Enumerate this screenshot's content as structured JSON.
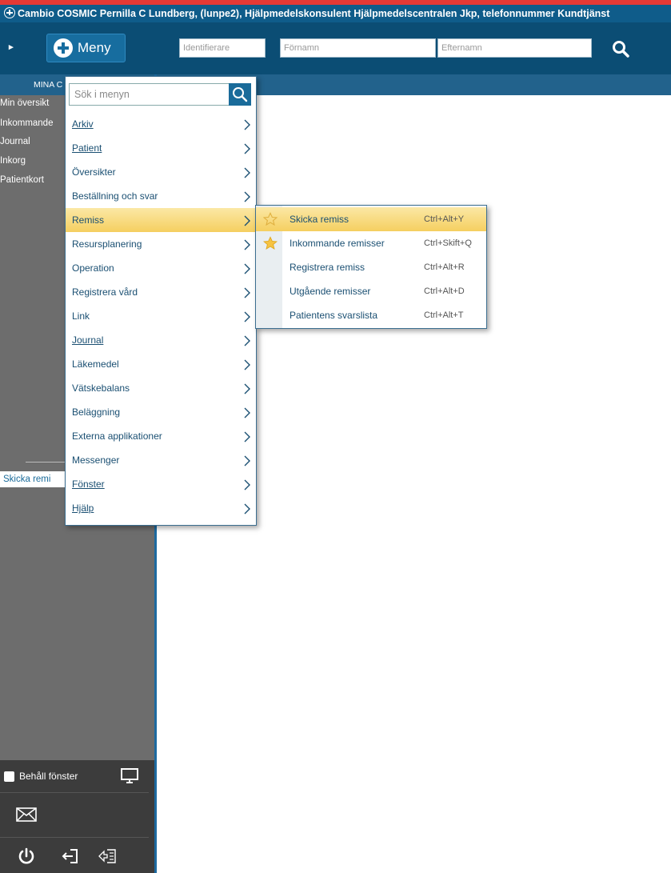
{
  "titlebar": {
    "text": "Cambio COSMIC Pernilla C  Lundberg, (lunpe2), Hjälpmedelskonsulent Hjälpmedelscentralen Jkp, telefonnummer Kundtjänst"
  },
  "toolbar": {
    "menu_label": "Meny",
    "identifier_placeholder": "Identifierare",
    "firstname_placeholder": "Förnamn",
    "lastname_placeholder": "Efternamn"
  },
  "sidebar": {
    "header": "MINA C",
    "items": [
      "Min översikt",
      "Inkommande",
      "Journal",
      "Inkorg",
      "Patientkort"
    ],
    "active_item": "Skicka remi",
    "keep_window_label": "Behåll fönster"
  },
  "menu": {
    "search_placeholder": "Sök i menyn",
    "items": [
      {
        "label": "Arkiv"
      },
      {
        "label": "Patient"
      },
      {
        "label": "Översikter"
      },
      {
        "label": "Beställning och svar"
      },
      {
        "label": "Remiss"
      },
      {
        "label": "Resursplanering"
      },
      {
        "label": "Operation"
      },
      {
        "label": "Registrera vård"
      },
      {
        "label": "Link"
      },
      {
        "label": "Journal"
      },
      {
        "label": "Läkemedel"
      },
      {
        "label": "Vätskebalans"
      },
      {
        "label": "Beläggning"
      },
      {
        "label": "Externa applikationer"
      },
      {
        "label": "Messenger"
      },
      {
        "label": "Fönster"
      },
      {
        "label": "Hjälp"
      }
    ],
    "highlighted": "Remiss"
  },
  "submenu": {
    "items": [
      {
        "label": "Skicka remiss",
        "shortcut": "Ctrl+Alt+Y",
        "star": "outline"
      },
      {
        "label": "Inkommande remisser",
        "shortcut": "Ctrl+Skift+Q",
        "star": "filled"
      },
      {
        "label": "Registrera remiss",
        "shortcut": "Ctrl+Alt+R",
        "star": "none"
      },
      {
        "label": "Utgående remisser",
        "shortcut": "Ctrl+Alt+D",
        "star": "none"
      },
      {
        "label": "Patientens svarslista",
        "shortcut": "Ctrl+Alt+T",
        "star": "none"
      }
    ]
  },
  "icons": {
    "collapse": "skip-to-start-icon",
    "search": "search-icon",
    "monitor": "monitor-icon",
    "mail": "mail-icon",
    "power": "power-icon",
    "logout": "logout-icon",
    "switch_user": "switch-user-icon"
  },
  "colors": {
    "title_bg": "#0f5c8a",
    "toolbar_bg": "#0b4d74",
    "sidebar_bg": "#6d6d6d",
    "highlight": "#f5cf60",
    "alert_bar": "#e53935"
  }
}
